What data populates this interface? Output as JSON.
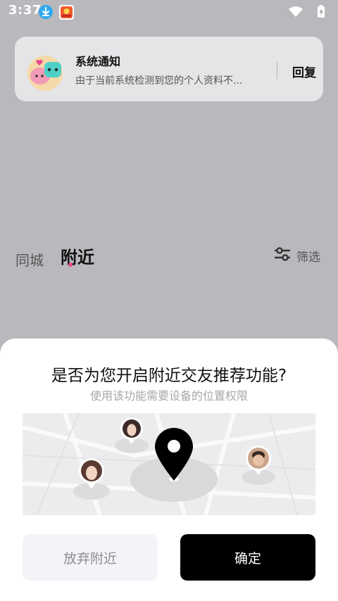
{
  "status_bar": {
    "time": "3:37",
    "icons": [
      "download-icon",
      "app-notification-icon",
      "wifi-icon",
      "battery-charging-icon"
    ]
  },
  "notification": {
    "title": "系统通知",
    "body": "由于当前系统检测到您的个人资料不...",
    "reply_label": "回复",
    "avatar_icon": "pig-mascot-icon"
  },
  "tabs": {
    "same_city": "同城",
    "nearby": "附近",
    "filter_label": "筛选",
    "filter_icon": "sliders-icon"
  },
  "dialog": {
    "title": "是否为您开启附近交友推荐功能?",
    "subtitle": "使用该功能需要设备的位置权限",
    "map_icon": "location-pin-icon",
    "cancel_label": "放弃附近",
    "confirm_label": "确定"
  },
  "colors": {
    "accent_dot": "#e94b8a",
    "confirm_bg": "#000000",
    "cancel_bg": "#f3f4f8"
  }
}
